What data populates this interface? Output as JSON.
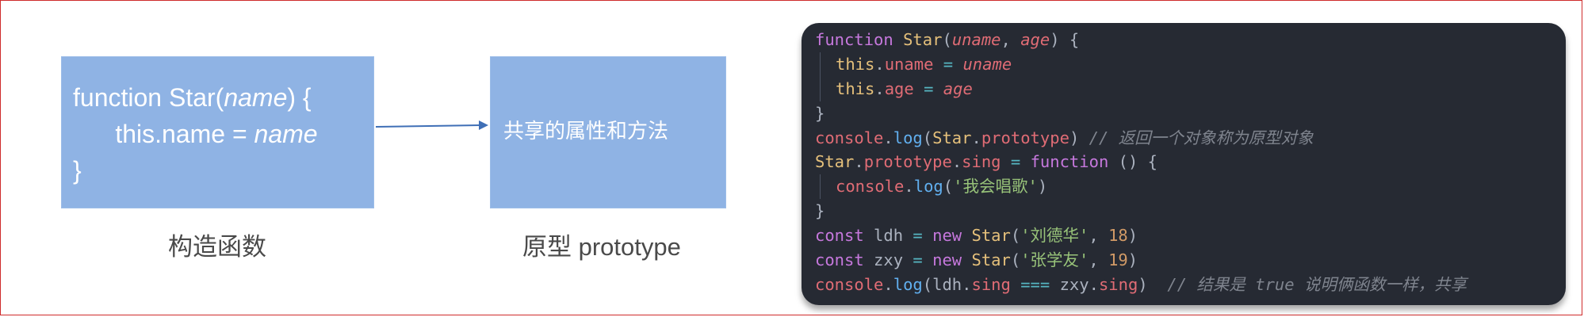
{
  "constructor_box": {
    "line1_pre": "function Star(",
    "line1_param": "name",
    "line1_post": ") {",
    "line2_pre": "this.name = ",
    "line2_param": "name",
    "line3": "}",
    "caption": "构造函数",
    "color": "#8fb3e4"
  },
  "prototype_box": {
    "text": "共享的属性和方法",
    "caption": "原型 prototype",
    "color": "#8fb3e4"
  },
  "arrow": {
    "color": "#3f6fb6",
    "from": "constructor_box",
    "to": "prototype_box"
  },
  "code_panel": {
    "background": "#262a33",
    "lines": [
      {
        "indent": false,
        "tokens": [
          {
            "t": "keyword",
            "v": "function"
          },
          {
            "t": "plain",
            "v": " "
          },
          {
            "t": "class",
            "v": "Star"
          },
          {
            "t": "punct",
            "v": "("
          },
          {
            "t": "param",
            "v": "uname"
          },
          {
            "t": "punct",
            "v": ", "
          },
          {
            "t": "param",
            "v": "age"
          },
          {
            "t": "punct",
            "v": ") {"
          }
        ]
      },
      {
        "indent": true,
        "tokens": [
          {
            "t": "this",
            "v": "this"
          },
          {
            "t": "punct",
            "v": "."
          },
          {
            "t": "prop",
            "v": "uname"
          },
          {
            "t": "op",
            "v": " = "
          },
          {
            "t": "param",
            "v": "uname"
          }
        ]
      },
      {
        "indent": true,
        "tokens": [
          {
            "t": "this",
            "v": "this"
          },
          {
            "t": "punct",
            "v": "."
          },
          {
            "t": "prop",
            "v": "age"
          },
          {
            "t": "op",
            "v": " = "
          },
          {
            "t": "param",
            "v": "age"
          }
        ]
      },
      {
        "indent": false,
        "tokens": [
          {
            "t": "punct",
            "v": "}"
          }
        ]
      },
      {
        "indent": false,
        "tokens": [
          {
            "t": "builtin",
            "v": "console"
          },
          {
            "t": "punct",
            "v": "."
          },
          {
            "t": "func",
            "v": "log"
          },
          {
            "t": "punct",
            "v": "("
          },
          {
            "t": "class",
            "v": "Star"
          },
          {
            "t": "punct",
            "v": "."
          },
          {
            "t": "prop",
            "v": "prototype"
          },
          {
            "t": "punct",
            "v": ") "
          },
          {
            "t": "comment",
            "v": "// 返回一个对象称为原型对象"
          }
        ]
      },
      {
        "indent": false,
        "tokens": [
          {
            "t": "class",
            "v": "Star"
          },
          {
            "t": "punct",
            "v": "."
          },
          {
            "t": "prop",
            "v": "prototype"
          },
          {
            "t": "punct",
            "v": "."
          },
          {
            "t": "prop",
            "v": "sing"
          },
          {
            "t": "op",
            "v": " = "
          },
          {
            "t": "keyword",
            "v": "function"
          },
          {
            "t": "punct",
            "v": " () {"
          }
        ]
      },
      {
        "indent": true,
        "tokens": [
          {
            "t": "builtin",
            "v": "console"
          },
          {
            "t": "punct",
            "v": "."
          },
          {
            "t": "func",
            "v": "log"
          },
          {
            "t": "punct",
            "v": "("
          },
          {
            "t": "string",
            "v": "'我会唱歌'"
          },
          {
            "t": "punct",
            "v": ")"
          }
        ]
      },
      {
        "indent": false,
        "tokens": [
          {
            "t": "punct",
            "v": "}"
          }
        ]
      },
      {
        "indent": false,
        "tokens": [
          {
            "t": "keyword",
            "v": "const"
          },
          {
            "t": "plain",
            "v": " ldh"
          },
          {
            "t": "op",
            "v": " = "
          },
          {
            "t": "keyword",
            "v": "new"
          },
          {
            "t": "plain",
            "v": " "
          },
          {
            "t": "class",
            "v": "Star"
          },
          {
            "t": "punct",
            "v": "("
          },
          {
            "t": "string",
            "v": "'刘德华'"
          },
          {
            "t": "punct",
            "v": ", "
          },
          {
            "t": "number",
            "v": "18"
          },
          {
            "t": "punct",
            "v": ")"
          }
        ]
      },
      {
        "indent": false,
        "tokens": [
          {
            "t": "keyword",
            "v": "const"
          },
          {
            "t": "plain",
            "v": " zxy"
          },
          {
            "t": "op",
            "v": " = "
          },
          {
            "t": "keyword",
            "v": "new"
          },
          {
            "t": "plain",
            "v": " "
          },
          {
            "t": "class",
            "v": "Star"
          },
          {
            "t": "punct",
            "v": "("
          },
          {
            "t": "string",
            "v": "'张学友'"
          },
          {
            "t": "punct",
            "v": ", "
          },
          {
            "t": "number",
            "v": "19"
          },
          {
            "t": "punct",
            "v": ")"
          }
        ]
      },
      {
        "indent": false,
        "tokens": [
          {
            "t": "builtin",
            "v": "console"
          },
          {
            "t": "punct",
            "v": "."
          },
          {
            "t": "func",
            "v": "log"
          },
          {
            "t": "punct",
            "v": "("
          },
          {
            "t": "plain",
            "v": "ldh"
          },
          {
            "t": "punct",
            "v": "."
          },
          {
            "t": "prop",
            "v": "sing"
          },
          {
            "t": "op",
            "v": " === "
          },
          {
            "t": "plain",
            "v": "zxy"
          },
          {
            "t": "punct",
            "v": "."
          },
          {
            "t": "prop",
            "v": "sing"
          },
          {
            "t": "punct",
            "v": ")  "
          },
          {
            "t": "comment",
            "v": "// 结果是 true 说明俩函数一样，共享"
          }
        ]
      }
    ]
  }
}
